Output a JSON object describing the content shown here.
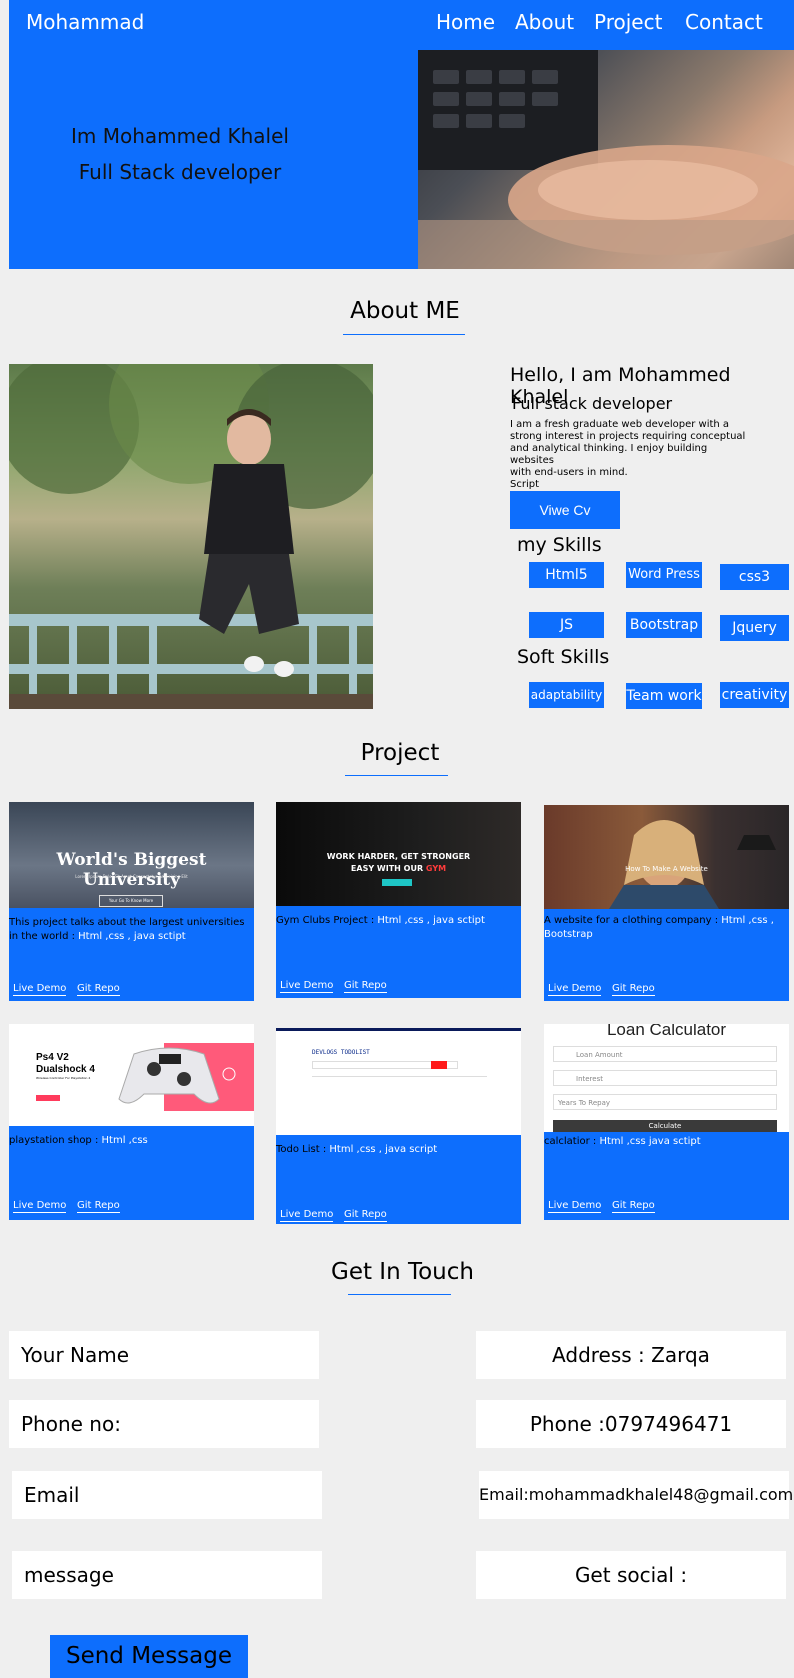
{
  "nav": {
    "brand": "Mohammad",
    "links": [
      "Home",
      "About",
      "Project",
      "Contact"
    ]
  },
  "hero": {
    "line1": "Im Mohammed Khalel",
    "line2": "Full Stack developer"
  },
  "about": {
    "title": "About  ME",
    "greeting": "Hello, I am Mohammed Khalel",
    "role": "Full stack developer",
    "bio": [
      "I am a fresh graduate web developer with a",
      "strong interest in projects requiring conceptual",
      "and analytical thinking. I enjoy building websites",
      "with end-users in mind.",
      "Script"
    ],
    "cv_button": "Viwe  Cv",
    "skills_title": "my Skills",
    "skills": [
      "Html5",
      "Word Press",
      "css3",
      "JS",
      "Bootstrap",
      "Jquery"
    ],
    "soft_title": "Soft Skills",
    "soft": [
      "adaptability",
      "Team work",
      "creativity"
    ]
  },
  "projects": {
    "title": "Project",
    "cards": [
      {
        "image_text": "World's Biggest University",
        "image_sub": "Lorem Ipsum Dolor Sit Amet Consectetur Adipisicing Elit",
        "image_btn": "Your Go To Know More",
        "desc_dark": "This project talks about the  largest universities in the world  :",
        "desc_light": " Html ,css ,  java sctipt",
        "demo": "Live Demo",
        "repo": "Git Repo"
      },
      {
        "image_text": "WORK HARDER, GET STRONGER",
        "image_sub": "EASY WITH OUR",
        "image_accent": "GYM",
        "desc_dark": "Gym Clubs Project  :",
        "desc_light": " Html ,css ,  java sctipt",
        "demo": "Live Demo",
        "repo": "Git Repo"
      },
      {
        "image_text": "How To Make A Website",
        "desc_dark": "A website for a clothing company :",
        "desc_light": " Html ,css ,  Bootstrap",
        "demo": "Live Demo",
        "repo": "Git Repo"
      },
      {
        "image_text": "Ps4 V2",
        "image_sub": "Dualshock 4",
        "image_small": "Wireless Controller For Playstation 4",
        "desc_dark": "playstation shop :",
        "desc_light": " Html ,css",
        "demo": "Live Demo",
        "repo": "Git Repo"
      },
      {
        "image_text": "DEVLOGS  TODOLIST",
        "desc_dark": "Todo List  :",
        "desc_light": " Html ,css ,  java script",
        "demo": "Live Demo",
        "repo": "Git Repo"
      },
      {
        "image_text": "Loan Calculator",
        "image_fields": [
          "Loan Amount",
          "Interest",
          "Years To Repay"
        ],
        "image_btn": "Calculate",
        "desc_dark": "calclatior  :",
        "desc_light": " Html ,css    java sctipt",
        "demo": "Live Demo",
        "repo": "Git Repo"
      }
    ]
  },
  "contact": {
    "title": "Get In Touch",
    "name_placeholder": "Your Name",
    "phone_placeholder": "Phone no:",
    "email_placeholder": "Email",
    "message_placeholder": "message",
    "address": "Address : Zarqa",
    "phone": "Phone :0797496471",
    "email": "Email:mohammadkhalel48@gmail.com",
    "social": "Get social :",
    "send": "Send Message"
  },
  "colors": {
    "accent": "#0d6efd",
    "background": "#efefef"
  }
}
